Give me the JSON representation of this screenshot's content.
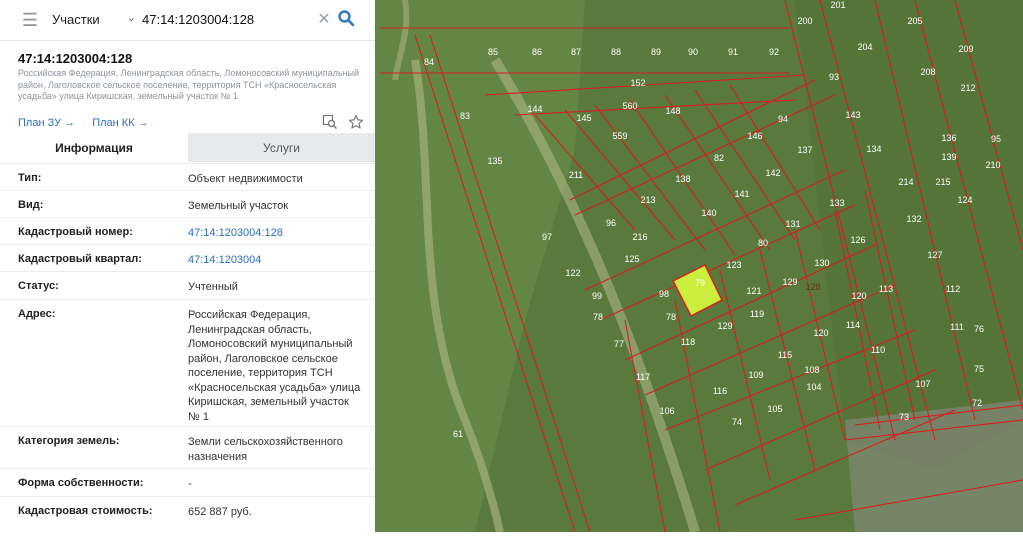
{
  "search": {
    "layer": "Участки",
    "query": "47:14:1203004:128"
  },
  "parcel": {
    "title": "47:14:1203004:128",
    "subtitle": "Российская Федерация, Ленинградская область, Ломоносовский муниципальный район, Лаголовское сельское поселение, территория ТСН «Красносельская усадьба» улица Киришская, земельный участок № 1",
    "links": {
      "plan_zu": "План ЗУ →",
      "plan_kk": "План КК →"
    }
  },
  "tabs": {
    "info": "Информация",
    "services": "Услуги"
  },
  "rows": [
    {
      "key": "Тип:",
      "value": "Объект недвижимости"
    },
    {
      "key": "Вид:",
      "value": "Земельный участок"
    },
    {
      "key": "Кадастровый номер:",
      "value": "47:14:1203004:128"
    },
    {
      "key": "Кадастровый квартал:",
      "value": "47:14:1203004"
    },
    {
      "key": "Статус:",
      "value": "Учтенный"
    },
    {
      "key": "Адрес:",
      "value": "Российская Федерация, Ленинградская область, Ломоносовский муниципальный район, Лаголовское сельское поселение, территория ТСН «Красносельская усадьба» улица Киришская, земельный участок № 1"
    },
    {
      "key": "Категория земель:",
      "value": "Земли сельскохозяйственного назначения"
    },
    {
      "key": "Форма собственности:",
      "value": "-"
    },
    {
      "key": "Кадастровая стоимость:",
      "value": "652 887 руб."
    }
  ],
  "map": {
    "selected_parcel": "128",
    "labels": [
      "201",
      "200",
      "204",
      "205",
      "209",
      "84",
      "85",
      "86",
      "87",
      "88",
      "89",
      "90",
      "91",
      "92",
      "152",
      "93",
      "208",
      "212",
      "83",
      "144",
      "560",
      "145",
      "148",
      "559",
      "143",
      "146",
      "94",
      "137",
      "136",
      "135",
      "211",
      "82",
      "142",
      "138",
      "134",
      "139",
      "95",
      "210",
      "214",
      "215",
      "96",
      "213",
      "141",
      "140",
      "133",
      "132",
      "124",
      "97",
      "216",
      "80",
      "131",
      "126",
      "125",
      "123",
      "130",
      "127",
      "122",
      "98",
      "79",
      "129",
      "128",
      "121",
      "120",
      "113",
      "112",
      "99",
      "78",
      "78",
      "129",
      "119",
      "120",
      "114",
      "111",
      "77",
      "118",
      "115",
      "110",
      "76",
      "117",
      "116",
      "109",
      "108",
      "107",
      "75",
      "106",
      "105",
      "104",
      "74",
      "73",
      "72"
    ],
    "river_label": "61",
    "colors": {
      "boundary": "#d81e1e",
      "selected_fill": "#c9ef3c",
      "field": "#5a7a3a"
    }
  }
}
